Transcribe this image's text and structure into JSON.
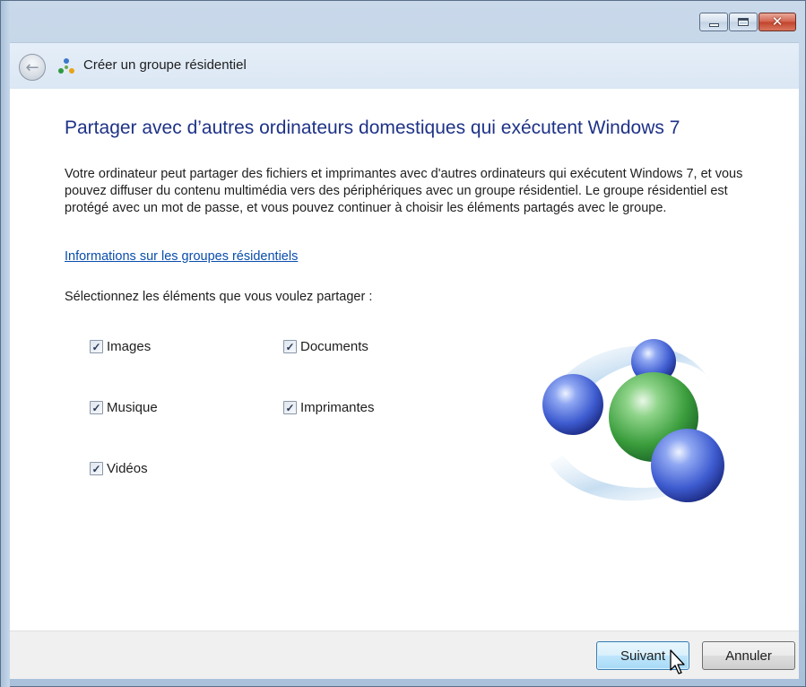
{
  "window": {
    "title": "Créer un groupe résidentiel",
    "caption_buttons": [
      "minimize",
      "maximize",
      "close"
    ]
  },
  "nav": {
    "back_icon": "back-arrow-icon",
    "title": "Créer un groupe résidentiel",
    "icon": "homegroup-icon"
  },
  "main": {
    "heading": "Partager avec d’autres ordinateurs domestiques qui exécutent Windows 7",
    "description": "Votre ordinateur peut partager des fichiers et imprimantes avec d'autres ordinateurs qui exécutent Windows 7, et vous pouvez diffuser du contenu multimédia vers des périphériques avec un groupe résidentiel. Le groupe résidentiel est protégé avec un mot de passe, et vous pouvez continuer à choisir les éléments partagés avec le groupe.",
    "info_link": "Informations sur les groupes résidentiels",
    "select_label": "Sélectionnez les éléments que vous voulez partager :",
    "items": [
      {
        "label": "Images",
        "checked": true
      },
      {
        "label": "Musique",
        "checked": true
      },
      {
        "label": "Vidéos",
        "checked": true
      },
      {
        "label": "Documents",
        "checked": true
      },
      {
        "label": "Imprimantes",
        "checked": true
      }
    ]
  },
  "footer": {
    "next_label": "Suivant",
    "cancel_label": "Annuler"
  },
  "colors": {
    "heading": "#1e3287",
    "link": "#0a4dab",
    "footer_bg": "#f0f0f0"
  }
}
